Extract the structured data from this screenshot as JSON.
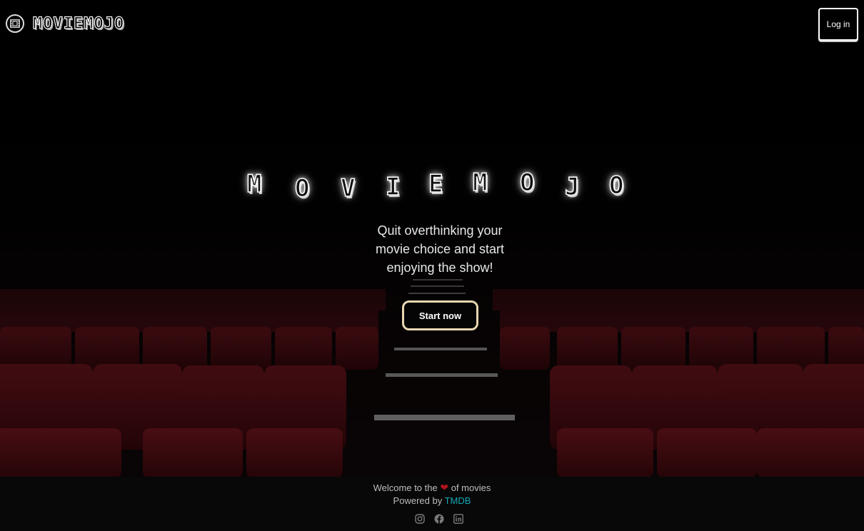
{
  "header": {
    "logo_text": "MOVIEMOJO",
    "logo_icon": "film-icon",
    "login_label": "Log in"
  },
  "hero": {
    "title_letters": [
      "M",
      "O",
      "V",
      "I",
      "E",
      "M",
      "O",
      "J",
      "O"
    ],
    "tagline": "Quit overthinking your movie choice and start enjoying the show!",
    "start_label": "Start now"
  },
  "footer": {
    "welcome_prefix": "Welcome to the",
    "welcome_suffix": "of movies",
    "heart_icon": "heart-icon",
    "powered_by": "Powered by",
    "provider": "TMDB",
    "socials": [
      "instagram-icon",
      "facebook-icon",
      "linkedin-icon"
    ]
  },
  "colors": {
    "accent_button_border": "#e7d7b0",
    "heart": "#b0141c",
    "link": "#17a8b8",
    "seat": "#4a0d12"
  }
}
